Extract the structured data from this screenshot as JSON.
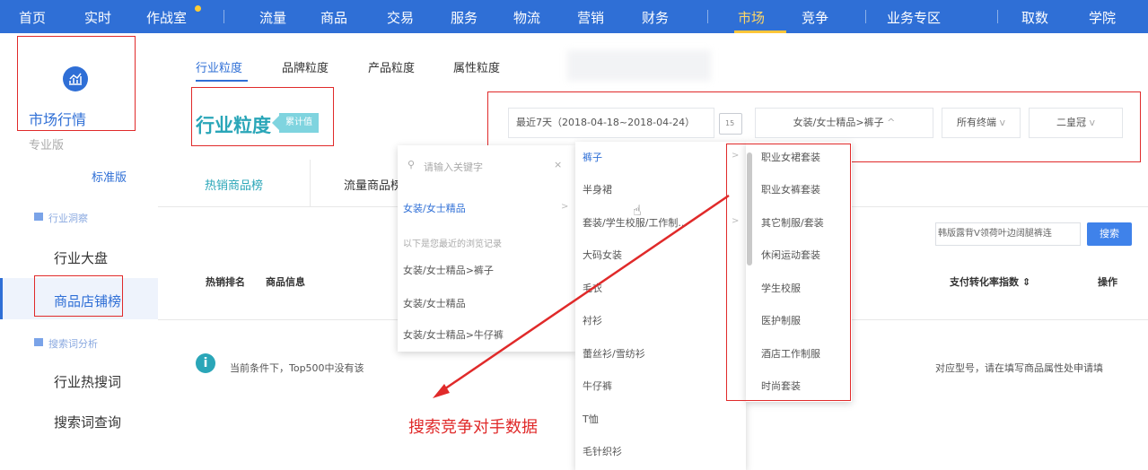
{
  "nav": {
    "items": [
      "首页",
      "实时",
      "作战室",
      "流量",
      "商品",
      "交易",
      "服务",
      "物流",
      "营销",
      "财务",
      "市场",
      "竞争",
      "业务专区",
      "取数",
      "学院"
    ],
    "active": "市场"
  },
  "sidebar": {
    "title": "市场行情",
    "version_pro": "专业版",
    "version_std": "标准版",
    "group1": "行业洞察",
    "item_overview": "行业大盘",
    "item_shop_rank": "商品店铺榜",
    "group2": "搜索词分析",
    "item_hot_search": "行业热搜词",
    "item_query": "搜索词查询"
  },
  "tabs": [
    "行业粒度",
    "品牌粒度",
    "产品粒度",
    "属性粒度"
  ],
  "page_title": "行业粒度",
  "badge": "累计值",
  "filters": {
    "date": "最近7天（2018-04-18~2018-04-24）",
    "category": "女装/女士精品>裤子",
    "terminal": "所有终端",
    "level": "二皇冠"
  },
  "subtabs": [
    "热销商品榜",
    "流量商品榜"
  ],
  "table_headers": {
    "rank": "热销排名",
    "product": "商品信息",
    "pay_rate": "支付转化率指数",
    "action": "操作"
  },
  "notice_left": "当前条件下，Top500中没有该",
  "notice_right": "对应型号，请在填写商品属性处申请填",
  "search": {
    "input_value": "韩版露背V领荷叶边阔腿裤连",
    "button": "搜索"
  },
  "dropdown1": {
    "placeholder": "请输入关键字",
    "top_category": "女装/女士精品",
    "history_label": "以下是您最近的浏览记录",
    "history": [
      "女装/女士精品>裤子",
      "女装/女士精品",
      "女装/女士精品>牛仔裤"
    ]
  },
  "dropdown2": {
    "items": [
      "裤子",
      "半身裙",
      "套装/学生校服/工作制...",
      "大码女装",
      "毛衣",
      "衬衫",
      "蕾丝衫/雪纺衫",
      "牛仔裤",
      "T恤",
      "毛针织衫"
    ]
  },
  "dropdown3": {
    "items": [
      "职业女裙套装",
      "职业女裤套装",
      "其它制服/套装",
      "休闲运动套装",
      "学生校服",
      "医护制服",
      "酒店工作制服",
      "时尚套装"
    ]
  },
  "annotation": "搜索竞争对手数据",
  "colors": {
    "nav_bg": "#2f6fd6",
    "accent": "#2aa6b8",
    "annotation": "#e02a2a"
  }
}
